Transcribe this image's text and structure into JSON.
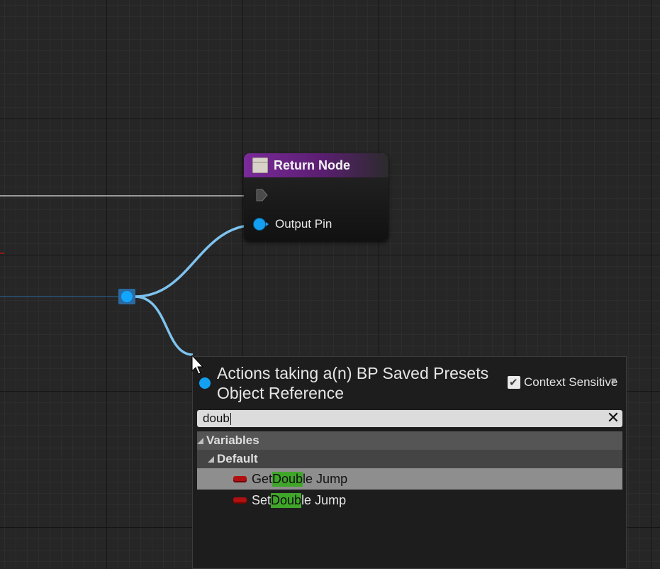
{
  "graph": {
    "return_node": {
      "title": "Return Node",
      "output_pin_label": "Output Pin",
      "header_color": "#7a2a9a",
      "pin_color": "#13a0f2"
    }
  },
  "action_menu": {
    "title": "Actions taking a(n) BP Saved Presets Object Reference",
    "context_sensitive_label": "Context Sensitive",
    "context_sensitive_checked": true,
    "search": {
      "value": "doub"
    },
    "tree": {
      "category": "Variables",
      "subcategory": "Default",
      "items": [
        {
          "prefix": "Get ",
          "match": "Doub",
          "suffix": "le Jump",
          "selected": true
        },
        {
          "prefix": "Set ",
          "match": "Doub",
          "suffix": "le Jump",
          "selected": false
        }
      ],
      "highlight_color": "#3fa62a",
      "variable_color": "#b01010"
    }
  }
}
